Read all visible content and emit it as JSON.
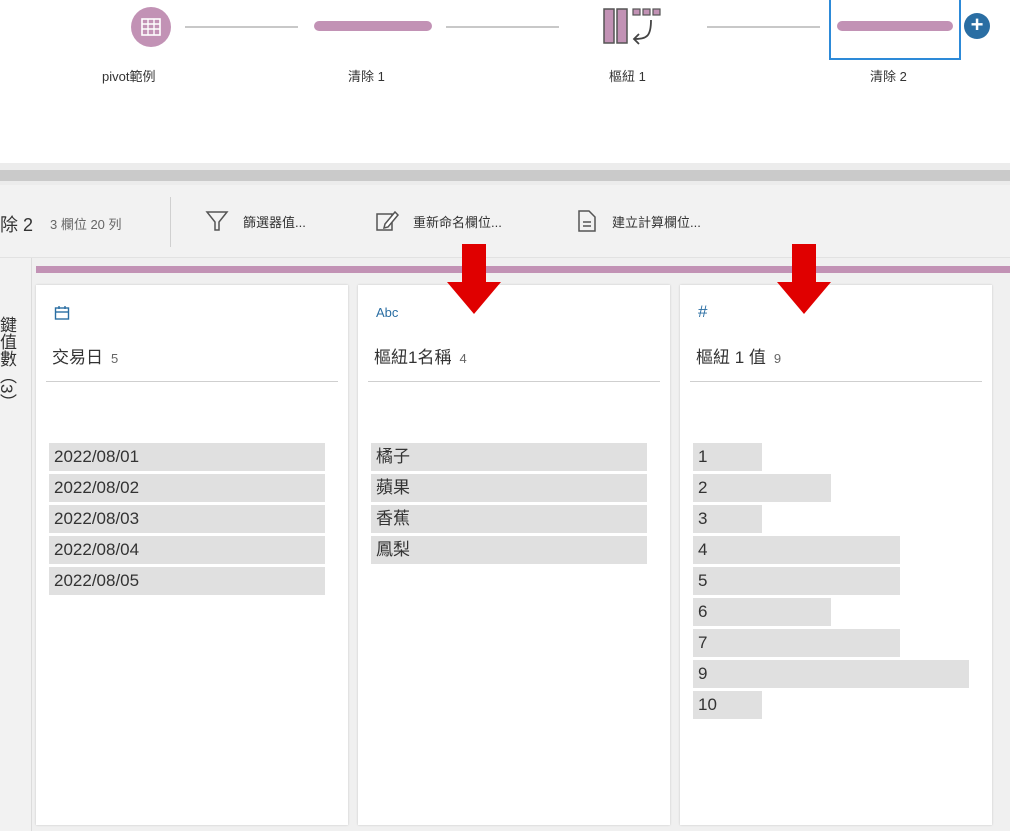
{
  "flow": {
    "nodes": [
      {
        "label": "pivot範例",
        "icon": "table-grid-icon"
      },
      {
        "label": "清除 1",
        "icon": "clean-step-bar"
      },
      {
        "label": "樞紐 1",
        "icon": "pivot-icon"
      },
      {
        "label": "清除 2",
        "icon": "clean-step-bar",
        "selected": true
      }
    ],
    "add_button": "+"
  },
  "toolbar": {
    "step_title": "除 2",
    "meta": "3 欄位  20 列",
    "filter_label": "篩選器值...",
    "rename_label": "重新命名欄位...",
    "calc_label": "建立計算欄位..."
  },
  "left_panel": {
    "vertical_text": "鍵值數（3）"
  },
  "colors": {
    "accent_purple": "#c292b5",
    "selected_blue": "#2d8ad8",
    "type_blue": "#2a6ea3",
    "arrow_red": "#e00000",
    "bar_gray": "#e0e0e0"
  },
  "cards": [
    {
      "type_icon": "calendar-icon",
      "title": "交易日",
      "count": "5",
      "values": [
        {
          "text": "2022/08/01",
          "fill": 1.0
        },
        {
          "text": "2022/08/02",
          "fill": 1.0
        },
        {
          "text": "2022/08/03",
          "fill": 1.0
        },
        {
          "text": "2022/08/04",
          "fill": 1.0
        },
        {
          "text": "2022/08/05",
          "fill": 1.0
        }
      ]
    },
    {
      "type_icon": "string-abc-icon",
      "type_text": "Abc",
      "title": "樞紐1名稱",
      "count": "4",
      "values": [
        {
          "text": "橘子",
          "fill": 1.0
        },
        {
          "text": "蘋果",
          "fill": 1.0
        },
        {
          "text": "香蕉",
          "fill": 1.0
        },
        {
          "text": "鳳梨",
          "fill": 1.0
        }
      ]
    },
    {
      "type_icon": "number-hash-icon",
      "type_text": "#",
      "title": "樞紐 1 值",
      "count": "9",
      "values": [
        {
          "text": "1",
          "fill": 0.25
        },
        {
          "text": "2",
          "fill": 0.5
        },
        {
          "text": "3",
          "fill": 0.25
        },
        {
          "text": "4",
          "fill": 0.75
        },
        {
          "text": "5",
          "fill": 0.75
        },
        {
          "text": "6",
          "fill": 0.5
        },
        {
          "text": "7",
          "fill": 0.75
        },
        {
          "text": "9",
          "fill": 1.0
        },
        {
          "text": "10",
          "fill": 0.25
        }
      ]
    }
  ]
}
